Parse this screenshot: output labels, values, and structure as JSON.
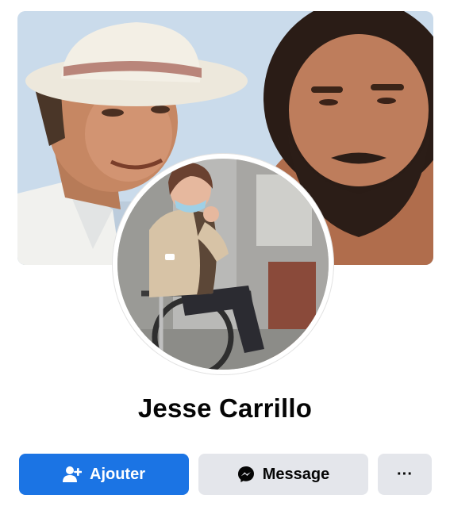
{
  "profile": {
    "name": "Jesse Carrillo"
  },
  "actions": {
    "add_label": "Ajouter",
    "message_label": "Message",
    "more_label": "···"
  },
  "icons": {
    "add": "add-friend-icon",
    "message": "messenger-icon",
    "more": "more-icon"
  },
  "colors": {
    "primary": "#1b74e4",
    "secondary_button": "#e4e6eb",
    "text": "#050505"
  }
}
